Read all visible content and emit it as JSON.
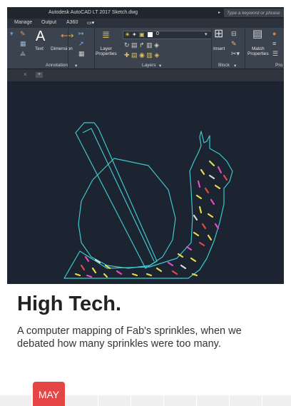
{
  "screenshot": {
    "window_title": "Autodesk AutoCAD LT 2017    Sketch.dwg",
    "search_placeholder": "Type a keyword or phrase",
    "tabs": [
      "Manage",
      "Output",
      "A360"
    ],
    "ribbon": {
      "text_label": "Text",
      "dimension_label": "Dimension",
      "layer_properties_label": "Layer\nProperties",
      "layer_value": "0",
      "insert_label": "Insert",
      "match_properties_label": "Match\nProperties",
      "panels": [
        "Annotation",
        "Layers",
        "Block",
        "Pro"
      ]
    }
  },
  "article": {
    "headline": "High Tech.",
    "description": "A computer mapping of Fab's sprinkles, when we debated how many sprinkles were too many."
  },
  "calendar": {
    "month": "MAY"
  },
  "colors": {
    "outline": "#3fc7cf",
    "sprinkles": [
      "#e8d94a",
      "#e84ac0",
      "#d8d8d8",
      "#e04a4a"
    ]
  }
}
